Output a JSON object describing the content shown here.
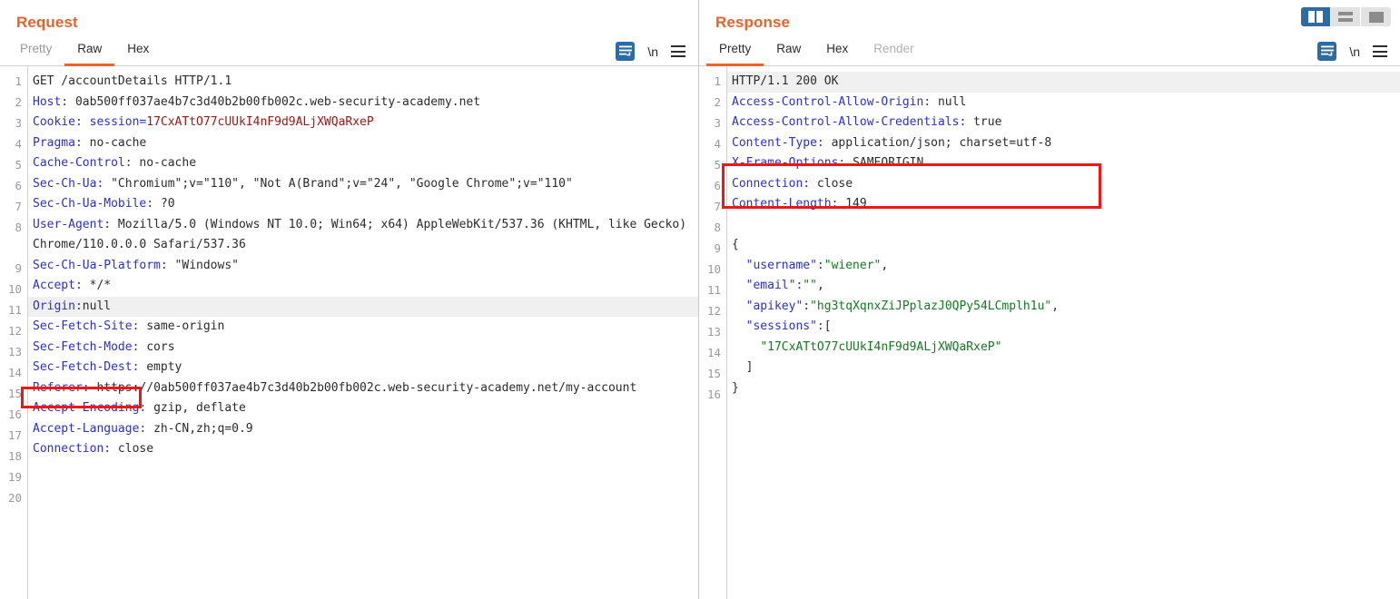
{
  "layout": {
    "buttons": [
      {
        "name": "vertical-split",
        "active": true
      },
      {
        "name": "horizontal-split",
        "active": false
      },
      {
        "name": "single-pane",
        "active": false
      }
    ],
    "accent_orange": "#e8622c",
    "accent_blue": "#2d6ca2",
    "annotation_color": "#f01616"
  },
  "request": {
    "title": "Request",
    "tabs": [
      {
        "label": "Pretty",
        "active": false
      },
      {
        "label": "Raw",
        "active": true
      },
      {
        "label": "Hex",
        "active": false
      }
    ],
    "tools": {
      "wrap_icon": "word-wrap-icon",
      "newline_label": "\\n",
      "menu_icon": "hamburger-menu-icon"
    },
    "total_lines": 20,
    "lines": [
      {
        "n": 1,
        "parts": [
          {
            "t": "GET /accountDetails HTTP/1.1",
            "c": "plain"
          }
        ]
      },
      {
        "n": 2,
        "parts": [
          {
            "t": "Host: ",
            "c": "hdr"
          },
          {
            "t": "0ab500ff037ae4b7c3d40b2b00fb002c.web-security-academy.net",
            "c": "plain"
          }
        ]
      },
      {
        "n": 3,
        "parts": [
          {
            "t": "Cookie: ",
            "c": "hdr"
          },
          {
            "t": "session=",
            "c": "hdr"
          },
          {
            "t": "17CxATtO77cUUkI4nF9d9ALjXWQaRxeP",
            "c": "red"
          }
        ]
      },
      {
        "n": 4,
        "parts": [
          {
            "t": "Pragma: ",
            "c": "hdr"
          },
          {
            "t": "no-cache",
            "c": "plain"
          }
        ]
      },
      {
        "n": 5,
        "parts": [
          {
            "t": "Cache-Control: ",
            "c": "hdr"
          },
          {
            "t": "no-cache",
            "c": "plain"
          }
        ]
      },
      {
        "n": 6,
        "parts": [
          {
            "t": "Sec-Ch-Ua: ",
            "c": "hdr"
          },
          {
            "t": "\"Chromium\";v=\"110\", \"Not A(Brand\";v=\"24\", \"Google Chrome\";v=\"110\"",
            "c": "plain"
          }
        ]
      },
      {
        "n": 7,
        "parts": [
          {
            "t": "Sec-Ch-Ua-Mobile: ",
            "c": "hdr"
          },
          {
            "t": "?0",
            "c": "plain"
          }
        ]
      },
      {
        "n": 8,
        "parts": [
          {
            "t": "User-Agent: ",
            "c": "hdr"
          },
          {
            "t": "Mozilla/5.0 (Windows NT 10.0; Win64; x64) AppleWebKit/537.36 (KHTML, like Gecko) Chrome/110.0.0.0 Safari/537.36",
            "c": "plain"
          }
        ]
      },
      {
        "n": 9,
        "parts": [
          {
            "t": "Sec-Ch-Ua-Platform: ",
            "c": "hdr"
          },
          {
            "t": "\"Windows\"",
            "c": "plain"
          }
        ]
      },
      {
        "n": 10,
        "parts": [
          {
            "t": "Accept: ",
            "c": "hdr"
          },
          {
            "t": "*/*",
            "c": "plain"
          }
        ]
      },
      {
        "n": 11,
        "highlight": true,
        "parts": [
          {
            "t": "Origin:",
            "c": "hdr"
          },
          {
            "t": "null",
            "c": "plain"
          }
        ]
      },
      {
        "n": 12,
        "parts": [
          {
            "t": "Sec-Fetch-Site: ",
            "c": "hdr"
          },
          {
            "t": "same-origin",
            "c": "plain"
          }
        ]
      },
      {
        "n": 13,
        "parts": [
          {
            "t": "Sec-Fetch-Mode: ",
            "c": "hdr"
          },
          {
            "t": "cors",
            "c": "plain"
          }
        ]
      },
      {
        "n": 14,
        "parts": [
          {
            "t": "Sec-Fetch-Dest: ",
            "c": "hdr"
          },
          {
            "t": "empty",
            "c": "plain"
          }
        ]
      },
      {
        "n": 15,
        "parts": [
          {
            "t": "Referer: ",
            "c": "hdr"
          },
          {
            "t": "https://0ab500ff037ae4b7c3d40b2b00fb002c.web-security-academy.net/my-account",
            "c": "plain"
          }
        ]
      },
      {
        "n": 16,
        "parts": [
          {
            "t": "Accept-Encoding: ",
            "c": "hdr"
          },
          {
            "t": "gzip, deflate",
            "c": "plain"
          }
        ]
      },
      {
        "n": 17,
        "parts": [
          {
            "t": "Accept-Language: ",
            "c": "hdr"
          },
          {
            "t": "zh-CN,zh;q=0.9",
            "c": "plain"
          }
        ]
      },
      {
        "n": 18,
        "parts": [
          {
            "t": "Connection: ",
            "c": "hdr"
          },
          {
            "t": "close",
            "c": "plain"
          }
        ]
      },
      {
        "n": 19,
        "parts": []
      },
      {
        "n": 20,
        "parts": []
      }
    ],
    "annotation": {
      "name": "origin-null-highlight",
      "target": "Origin:null"
    }
  },
  "response": {
    "title": "Response",
    "tabs": [
      {
        "label": "Pretty",
        "active": true
      },
      {
        "label": "Raw",
        "active": false
      },
      {
        "label": "Hex",
        "active": false
      },
      {
        "label": "Render",
        "active": false,
        "disabled": true
      }
    ],
    "tools": {
      "wrap_icon": "word-wrap-icon",
      "newline_label": "\\n",
      "menu_icon": "hamburger-menu-icon"
    },
    "total_lines": 16,
    "lines": [
      {
        "n": 1,
        "highlight": true,
        "parts": [
          {
            "t": "HTTP/1.1 200 OK",
            "c": "plain"
          }
        ]
      },
      {
        "n": 2,
        "parts": [
          {
            "t": "Access-Control-Allow-Origin: ",
            "c": "hdr"
          },
          {
            "t": "null",
            "c": "plain"
          }
        ]
      },
      {
        "n": 3,
        "parts": [
          {
            "t": "Access-Control-Allow-Credentials: ",
            "c": "hdr"
          },
          {
            "t": "true",
            "c": "plain"
          }
        ]
      },
      {
        "n": 4,
        "parts": [
          {
            "t": "Content-Type: ",
            "c": "hdr"
          },
          {
            "t": "application/json; charset=utf-8",
            "c": "plain"
          }
        ]
      },
      {
        "n": 5,
        "parts": [
          {
            "t": "X-Frame-Options: ",
            "c": "hdr"
          },
          {
            "t": "SAMEORIGIN",
            "c": "plain"
          }
        ]
      },
      {
        "n": 6,
        "parts": [
          {
            "t": "Connection: ",
            "c": "hdr"
          },
          {
            "t": "close",
            "c": "plain"
          }
        ]
      },
      {
        "n": 7,
        "parts": [
          {
            "t": "Content-Length: ",
            "c": "hdr"
          },
          {
            "t": "149",
            "c": "plain"
          }
        ]
      },
      {
        "n": 8,
        "parts": []
      },
      {
        "n": 9,
        "parts": [
          {
            "t": "{",
            "c": "plain"
          }
        ]
      },
      {
        "n": 10,
        "parts": [
          {
            "t": "  \"username\":",
            "c": "blue-k"
          },
          {
            "t": "\"wiener\"",
            "c": "green"
          },
          {
            "t": ",",
            "c": "plain"
          }
        ]
      },
      {
        "n": 11,
        "parts": [
          {
            "t": "  \"email\":",
            "c": "blue-k"
          },
          {
            "t": "\"\"",
            "c": "green"
          },
          {
            "t": ",",
            "c": "plain"
          }
        ]
      },
      {
        "n": 12,
        "parts": [
          {
            "t": "  \"apikey\":",
            "c": "blue-k"
          },
          {
            "t": "\"hg3tqXqnxZiJPplazJ0QPy54LCmplh1u\"",
            "c": "green"
          },
          {
            "t": ",",
            "c": "plain"
          }
        ]
      },
      {
        "n": 13,
        "parts": [
          {
            "t": "  \"sessions\":",
            "c": "blue-k"
          },
          {
            "t": "[",
            "c": "plain"
          }
        ]
      },
      {
        "n": 14,
        "parts": [
          {
            "t": "    ",
            "c": "plain"
          },
          {
            "t": "\"17CxATtO77cUUkI4nF9d9ALjXWQaRxeP\"",
            "c": "green"
          }
        ]
      },
      {
        "n": 15,
        "parts": [
          {
            "t": "  ]",
            "c": "plain"
          }
        ]
      },
      {
        "n": 16,
        "parts": [
          {
            "t": "}",
            "c": "plain"
          }
        ]
      }
    ],
    "annotation": {
      "name": "cors-headers-highlight",
      "target": "Access-Control-Allow-Origin / Credentials"
    }
  }
}
